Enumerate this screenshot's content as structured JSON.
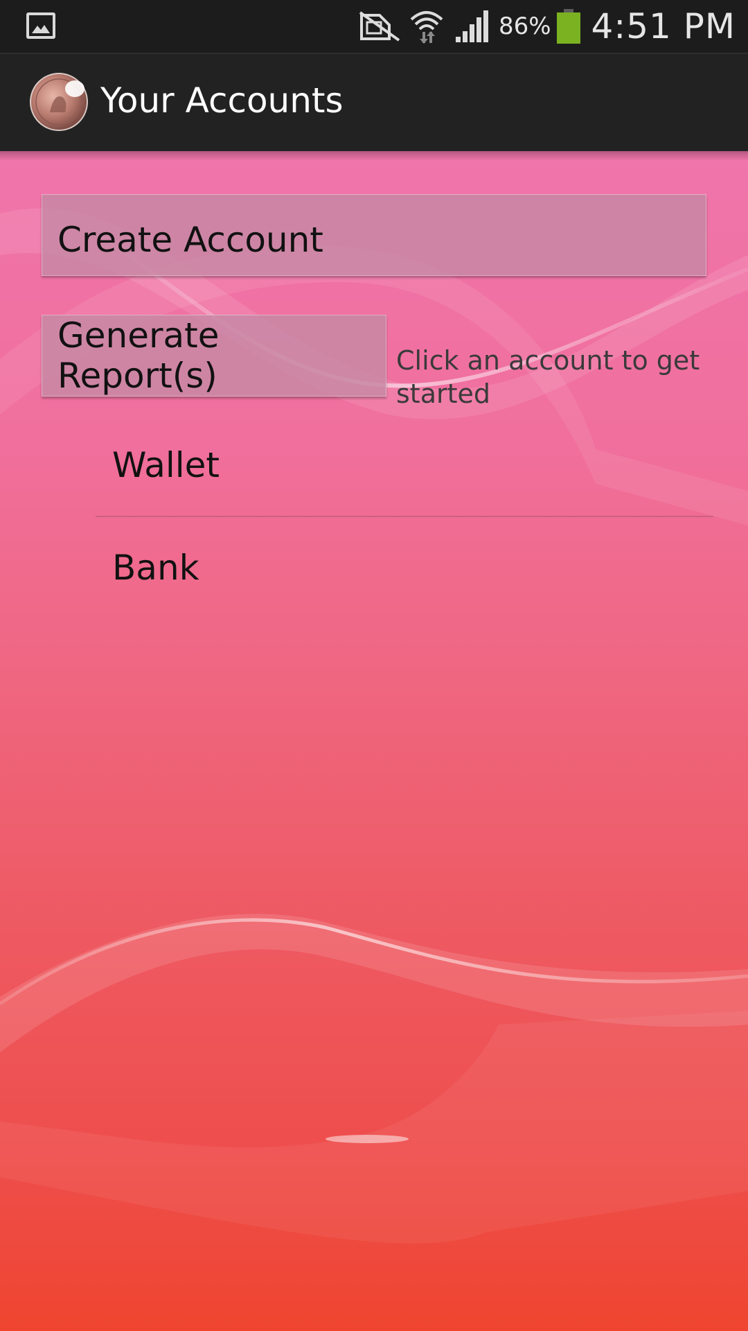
{
  "status_bar": {
    "gallery_icon": "picture-icon",
    "icons": [
      "no-sim-icon",
      "wifi-icon",
      "signal-icon"
    ],
    "battery_percent": "86%",
    "battery_color": "#7bb221",
    "time": "4:51 PM"
  },
  "action_bar": {
    "app_icon": "coin-icon",
    "title": "Your Accounts"
  },
  "main": {
    "create_button": "Create Account",
    "report_button": "Generate Report(s)",
    "hint": "Click an account to get started",
    "accounts": [
      {
        "name": "Wallet"
      },
      {
        "name": "Bank"
      }
    ]
  }
}
